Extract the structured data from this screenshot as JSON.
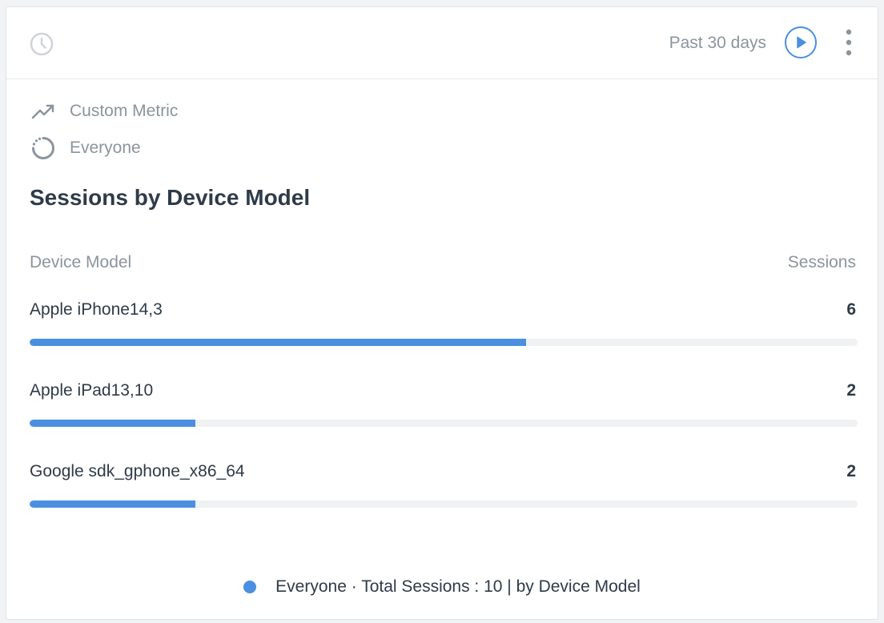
{
  "header": {
    "period_label": "Past 30 days"
  },
  "meta": {
    "metric_label": "Custom Metric",
    "segment_label": "Everyone"
  },
  "chart_data": {
    "type": "bar",
    "orientation": "horizontal",
    "title": "Sessions by Device Model",
    "category_header": "Device Model",
    "value_header": "Sessions",
    "categories": [
      "Apple iPhone14,3",
      "Apple iPad13,10",
      "Google sdk_gphone_x86_64"
    ],
    "values": [
      6,
      2,
      2
    ],
    "xlim": [
      0,
      10
    ],
    "series": [
      {
        "name": "Everyone",
        "values": [
          6,
          2,
          2
        ]
      }
    ],
    "grid": false,
    "legend_placement": "bottom"
  },
  "legend": {
    "segment": "Everyone",
    "separator": " · ",
    "summary": "Total Sessions : 10 | by Device Model"
  },
  "colors": {
    "accent": "#4a8fe0",
    "track": "#f0f1f3",
    "text_primary": "#2f3b48",
    "text_muted": "#8c949d"
  },
  "icons": {
    "header_left": "clock-icon",
    "play": "play-icon",
    "more": "more-vertical-icon",
    "metric": "trending-up-icon",
    "segment": "segment-circle-icon"
  }
}
